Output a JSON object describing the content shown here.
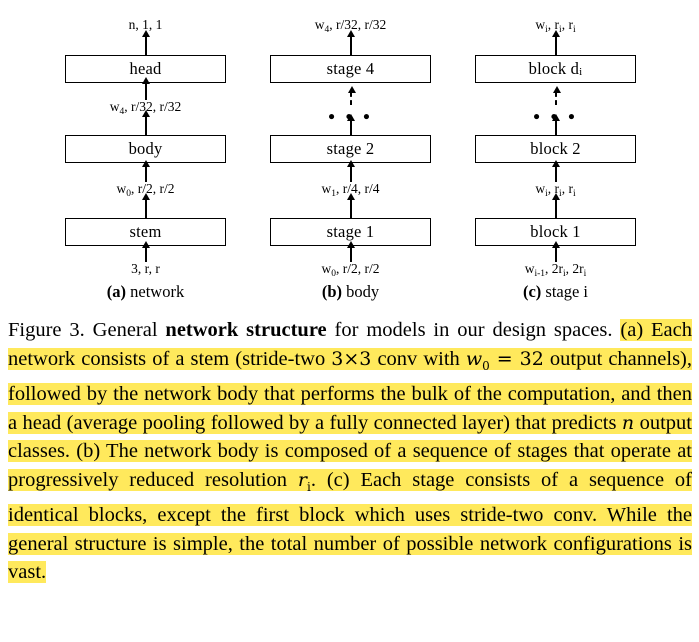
{
  "figure": {
    "columns": [
      {
        "id": "a",
        "caption_marker": "(a)",
        "caption_text": " network",
        "top_label": "n, 1, 1",
        "boxes": [
          {
            "label": "head"
          },
          {
            "label": "body"
          },
          {
            "label": "stem"
          }
        ],
        "label_upper": "w4, r/32, r/32",
        "label_upper_base": "w",
        "label_upper_sub": "4",
        "label_upper_rest": ", r/32, r/32",
        "label_lower_base": "w",
        "label_lower_sub": "0",
        "label_lower_rest": ", r/2, r/2",
        "bottom_label": "3, r, r",
        "has_ellipsis": false
      },
      {
        "id": "b",
        "caption_marker": "(b)",
        "caption_text": " body",
        "top_label_base": "w",
        "top_label_sub": "4",
        "top_label_rest": ", r/32, r/32",
        "boxes": [
          {
            "label": "stage 4"
          },
          {
            "label": "stage 2"
          },
          {
            "label": "stage 1"
          }
        ],
        "label_lower_base": "w",
        "label_lower_sub": "1",
        "label_lower_rest": ", r/4, r/4",
        "bottom_label_base": "w",
        "bottom_label_sub": "0",
        "bottom_label_rest": ", r/2, r/2",
        "has_ellipsis": true,
        "ellipsis": "• • •"
      },
      {
        "id": "c",
        "caption_marker": "(c)",
        "caption_text": " stage i",
        "top_label_base": "w",
        "top_label_sub": "i",
        "top_label_rest": ", r",
        "boxes": [
          {
            "label": "block d",
            "sub": "i"
          },
          {
            "label": "block 2"
          },
          {
            "label": "block 1"
          }
        ],
        "has_ellipsis": true,
        "ellipsis": "• • •"
      }
    ],
    "labels": {
      "a_top": "n, 1, 1",
      "a_bottom": "3, r, r",
      "b_dots": "• • •",
      "c_dots": "• • •"
    }
  },
  "caption": {
    "figure_number": "Figure 3.",
    "intro_before_bold": " General ",
    "bold_phrase": "network structure",
    "intro_after_bold": " for models in our design spaces. ",
    "part_a_1": "(a) Each network consists of a stem (stride-two ",
    "math_3x3": "3×3",
    "part_a_2": " conv with ",
    "math_w0": "w",
    "math_w0_sub": "0",
    "math_eq32": "= 32",
    "part_a_3": " output channels), followed by the network body that performs the bulk of the computation, and then a head (average pooling followed by a fully connected layer) that predicts ",
    "math_n": "n",
    "part_a_4": " output classes. ",
    "part_b_1": "(b) The network body is composed of a sequence of stages that operate at progressively reduced resolution ",
    "math_ri": "r",
    "math_ri_sub": "i",
    "part_b_2": ". ",
    "part_c_1": "(c) Each stage consists of a sequence of identical blocks, except the first block which uses stride-two conv. While the general structure is simple, the total number of possible network configurations is vast."
  },
  "colors": {
    "highlight": "#FFE95C",
    "text": "#000000",
    "background": "#FFFFFF",
    "box_border": "#000000"
  }
}
